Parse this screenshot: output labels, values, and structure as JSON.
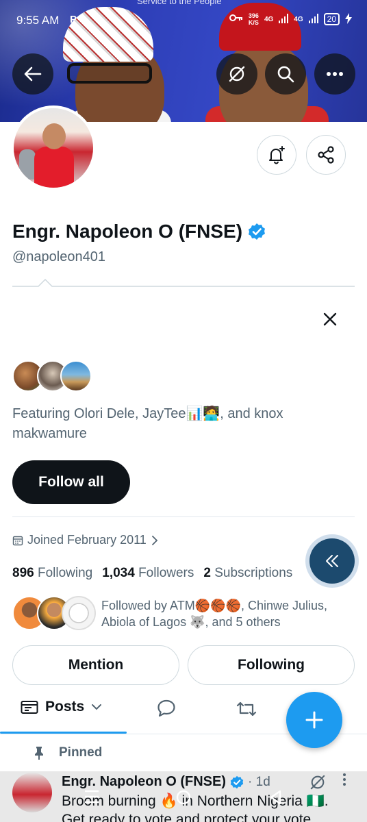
{
  "status_bar": {
    "time": "9:55 AM",
    "notif": "P",
    "speed_value": "396",
    "speed_unit": "K/S",
    "net1": "4G",
    "net2": "4G",
    "battery": "20"
  },
  "banner": {
    "tagline": "Service to the People",
    "back_icon": "arrow-left-icon",
    "grok_icon": "grok-icon",
    "search_icon": "search-icon",
    "more_icon": "more-horizontal-icon"
  },
  "profile": {
    "name": "Engr. Napoleon O (FNSE)",
    "handle": "@napoleon401",
    "verified": true,
    "joined": "Joined February 2011",
    "following_count": "896",
    "following_label": "Following",
    "followers_count": "1,034",
    "followers_label": "Followers",
    "subscriptions_count": "2",
    "subscriptions_label": "Subscriptions"
  },
  "suggestions": {
    "featuring": "Featuring Olori Dele, JayTee📊🧑‍💻, and knox makwamure",
    "follow_all": "Follow all"
  },
  "followed_by": "Followed by ATM🏀🏀🏀, Chinwe Julius, Abiola of Lagos 🐺, and 5 others",
  "actions": {
    "mention": "Mention",
    "following": "Following"
  },
  "tabs": {
    "posts": "Posts"
  },
  "pinned": {
    "label": "Pinned",
    "author": "Engr. Napoleon O (FNSE)",
    "time": "· 1d",
    "text_line1": "Broom burning 🔥 in Northern Nigeria 🇳🇬.",
    "text_line2": "Get ready to vote and protect your vote"
  },
  "colors": {
    "accent": "#1d9bf0",
    "text_primary": "#0f1419",
    "text_secondary": "#536471",
    "banner": "#2e3fb8"
  }
}
